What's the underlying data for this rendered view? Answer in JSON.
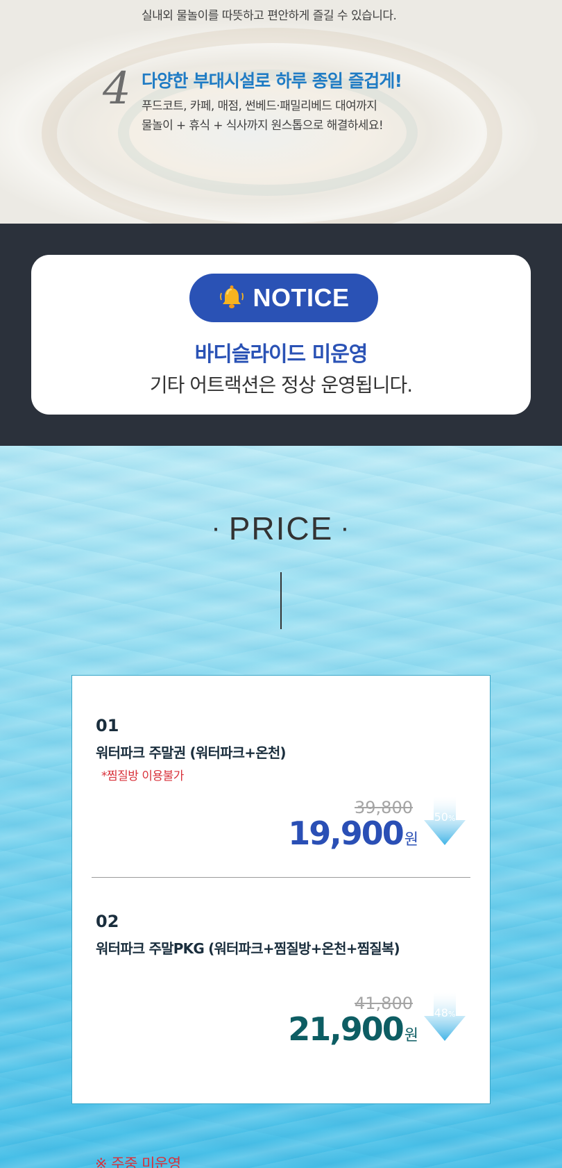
{
  "features": {
    "item3": {
      "desc": "실내외 물놀이를 따뜻하고 편안하게 즐길 수 있습니다."
    },
    "item4": {
      "number": "4",
      "title": "다양한 부대시설로 하루 종일 즐겁게!",
      "desc_line1": "푸드코트, 카페, 매점, 썬베드·패밀리베드 대여까지",
      "desc_line2": "물놀이 + 휴식 + 식사까지 원스톱으로 해결하세요!"
    }
  },
  "notice": {
    "label": "NOTICE",
    "title": "바디슬라이드 미운영",
    "text": "기타 어트랙션은 정상 운영됩니다."
  },
  "price": {
    "heading": "PRICE",
    "items": [
      {
        "number": "01",
        "name": "워터파크 주말권 (워터파크+온천)",
        "note": "*찜질방 이용불가",
        "original_price": "39,800",
        "sale_price": "19,900",
        "currency": "원",
        "discount": "50",
        "discount_unit": "%"
      },
      {
        "number": "02",
        "name": "워터파크 주말PKG (워터파크+찜질방+온천+찜질복)",
        "original_price": "41,800",
        "sale_price": "21,900",
        "currency": "원",
        "discount": "48",
        "discount_unit": "%"
      }
    ],
    "footnote": "※ 주중 미운영"
  },
  "colors": {
    "notice_band": "#2b313b",
    "notice_blue": "#2a52b5",
    "feature_title_blue": "#1f7bc4",
    "sale_blue": "#2a4fb5",
    "sale_teal": "#0d5d63",
    "note_red": "#d8313a",
    "arrow_blue": "#3fb3e6"
  }
}
